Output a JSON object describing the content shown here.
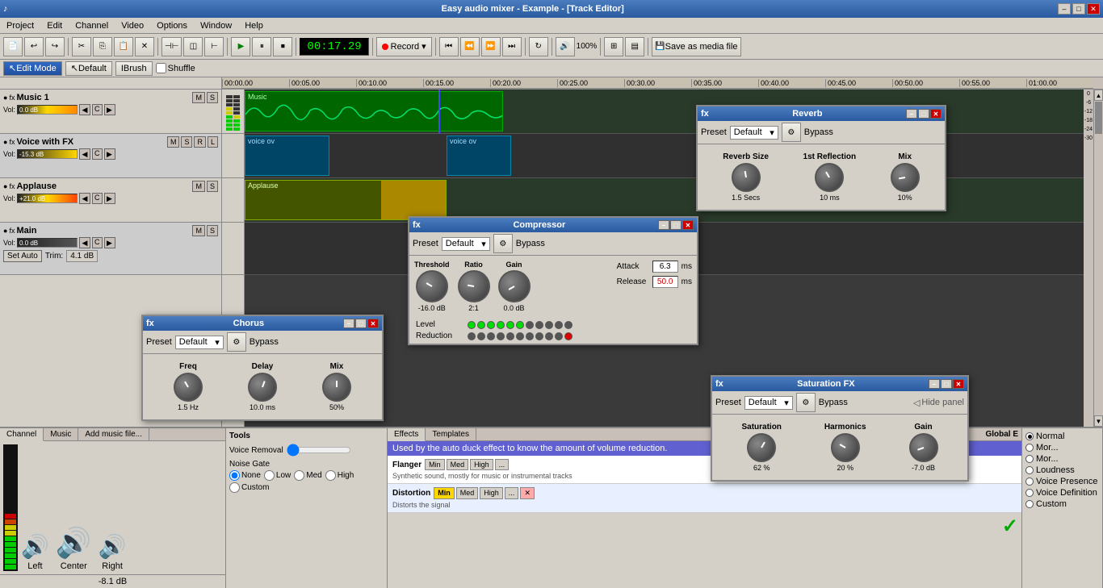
{
  "app": {
    "title": "Easy audio mixer - Example - [Track Editor]",
    "icon": "♪"
  },
  "titlebar": {
    "minimize": "–",
    "maximize": "□",
    "close": "✕"
  },
  "menu": {
    "items": [
      "Project",
      "Edit",
      "Channel",
      "Video",
      "Options",
      "Window",
      "Help"
    ]
  },
  "toolbar": {
    "time": "00:17.29",
    "record_label": "Record",
    "volume_label": "100%",
    "save_label": "Save as media file"
  },
  "edit_bar": {
    "edit_mode": "Edit Mode",
    "default": "Default",
    "brush": "Brush",
    "shuffle": "Shuffle"
  },
  "tracks": [
    {
      "name": "Music 1",
      "vol": "0.0 dB",
      "vol_display": "M",
      "buttons": [
        "M",
        "S"
      ],
      "pan": "C",
      "vol_val": "-8.1 dB"
    },
    {
      "name": "Voice with FX",
      "buttons": [
        "M",
        "S",
        "R",
        "L"
      ],
      "pan": "C",
      "vol_val": "-15.3 dB"
    },
    {
      "name": "Applause",
      "buttons": [
        "M",
        "S"
      ],
      "pan": "C",
      "vol_val": "+21.0 dB"
    },
    {
      "name": "Main",
      "buttons": [
        "M",
        "S"
      ],
      "pan": "C",
      "vol_val": "0.0 dB",
      "trim": "4.1 dB"
    }
  ],
  "ruler": {
    "ticks": [
      "00:00.00",
      "00:05.00",
      "00:10.00",
      "00:15.00",
      "00:20.00",
      "00:25.00",
      "00:30.00",
      "00:35.00",
      "00:40.00",
      "00:45.00",
      "00:50.00",
      "00:55.00",
      "01:00.00"
    ]
  },
  "chorus_dialog": {
    "title": "Chorus",
    "preset_label": "Preset",
    "preset_value": "Default",
    "bypass_label": "Bypass",
    "freq_label": "Freq",
    "freq_value": "1.5 Hz",
    "delay_label": "Delay",
    "delay_value": "10.0 ms",
    "mix_label": "Mix",
    "mix_value": "50%"
  },
  "reverb_dialog": {
    "title": "Reverb",
    "preset_label": "Preset",
    "preset_value": "Default",
    "bypass_label": "Bypass",
    "reverb_size_label": "Reverb Size",
    "reflection_label": "1st Reflection",
    "mix_label": "Mix",
    "reverb_size_value": "1.5 Secs",
    "reflection_value": "10 ms",
    "mix_value": "10%"
  },
  "compressor_dialog": {
    "title": "Compressor",
    "preset_label": "Preset",
    "preset_value": "Default",
    "bypass_label": "Bypass",
    "threshold_label": "Threshold",
    "threshold_value": "-16.0 dB",
    "ratio_label": "Ratio",
    "ratio_value": "2:1",
    "gain_label": "Gain",
    "gain_value": "0.0 dB",
    "attack_label": "Attack",
    "attack_value": "6.3",
    "attack_unit": "ms",
    "release_label": "Release",
    "release_value": "50.0",
    "release_unit": "ms",
    "level_label": "Level",
    "reduction_label": "Reduction"
  },
  "saturation_dialog": {
    "title": "Saturation FX",
    "preset_label": "Preset",
    "preset_value": "Default",
    "bypass_label": "Bypass",
    "hide_panel": "Hide panel",
    "saturation_label": "Saturation",
    "saturation_value": "62 %",
    "harmonics_label": "Harmonics",
    "harmonics_value": "20 %",
    "gain_label": "Gain",
    "gain_value": "-7.0 dB",
    "radio_options": [
      "Normal",
      "More saturation",
      "More harmonics",
      "Loudness",
      "Voice Presence",
      "Voice Definition",
      "Custom"
    ]
  },
  "effects_panel": {
    "tabs": [
      "Effects",
      "Templates"
    ],
    "global_label": "Global E",
    "info_text": "Used by the auto duck effect to know the amount of volume reduction.",
    "effects": [
      {
        "name": "Flanger",
        "desc": "Synthetic sound, mostly for music or instrumental tracks",
        "presets": [
          "Min",
          "Med",
          "High",
          "..."
        ]
      },
      {
        "name": "Distortion",
        "desc": "Distorts the signal",
        "presets": [
          "Min",
          "Med",
          "High",
          "..."
        ],
        "selected": true
      }
    ]
  },
  "bottom_panel": {
    "tabs": [
      "Channel",
      "Music",
      "Add music file..."
    ],
    "track_name": "Music 1",
    "speakers": [
      "Left",
      "Center",
      "Right"
    ],
    "db_value": "-8.1 dB",
    "tools_label": "Tools",
    "voice_removal_label": "Voice Removal",
    "noise_gate_label": "Noise Gate",
    "noise_gate_options": [
      "None",
      "Low",
      "Med",
      "High"
    ],
    "custom_label": "Custom"
  }
}
